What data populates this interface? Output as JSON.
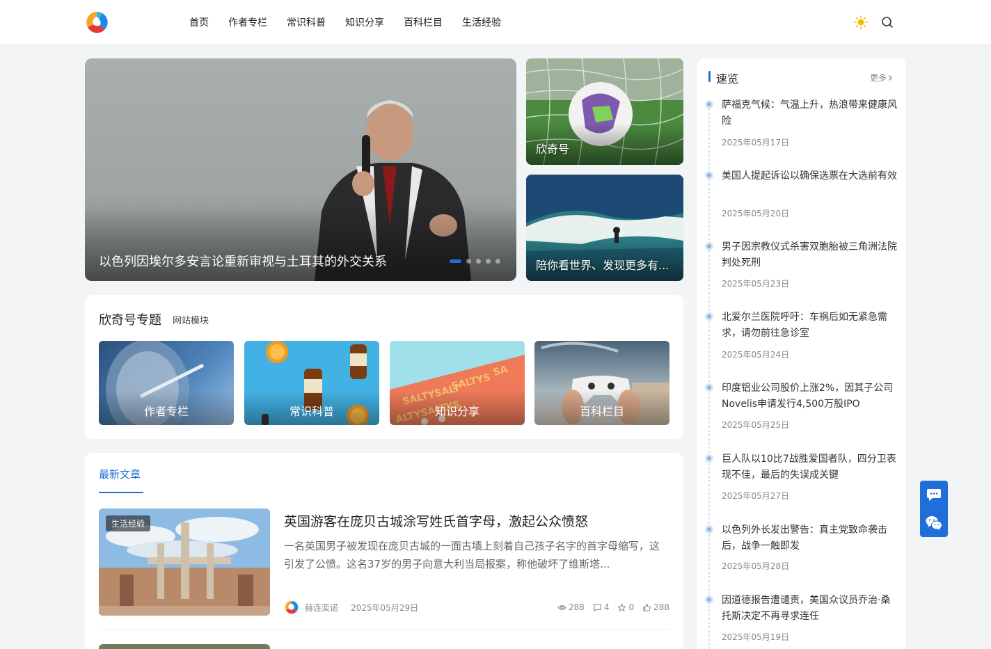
{
  "nav": [
    "首页",
    "作者专栏",
    "常识科普",
    "知识分享",
    "百科栏目",
    "生活经验"
  ],
  "icons": {
    "theme": "sun-icon",
    "search": "search-icon",
    "comment": "comment-icon",
    "wechat": "wechat-icon"
  },
  "colors": {
    "accent": "#1e6fd9",
    "theme_icon": "#f5b800"
  },
  "slider": {
    "title": "以色列因埃尔多安言论重新审视与土耳其的外交关系",
    "dots": 5,
    "active_dot": 1
  },
  "side_cards": [
    "欣奇号",
    "陪你看世界、发现更多有..."
  ],
  "topics": {
    "title": "欣奇号专题",
    "subtitle": "网站模块",
    "items": [
      "作者专栏",
      "常识科普",
      "知识分享",
      "百科栏目"
    ]
  },
  "latest": {
    "tab": "最新文章",
    "post": {
      "tag": "生活经验",
      "title": "英国游客在庞贝古城涂写姓氏首字母，激起公众愤怒",
      "excerpt": "一名英国男子被发现在庞贝古城的一面古墙上刻着自己孩子名字的首字母缩写，这引发了公愤。这名37岁的男子向意大利当局报案，称他破坏了维斯塔...",
      "author": "赫连栾诺",
      "date": "2025年05月29日",
      "views": "288",
      "comments": "4",
      "favorites": "0",
      "likes": "288"
    }
  },
  "sidebar": {
    "title": "速览",
    "more": "更多",
    "items": [
      {
        "title": "萨福克气候：气温上升，热浪带来健康风险",
        "date": "2025年05月17日"
      },
      {
        "title": "美国人提起诉讼以确保选票在大选前有效",
        "date": "2025年05月20日"
      },
      {
        "title": "男子因宗教仪式杀害双胞胎被三角洲法院判处死刑",
        "date": "2025年05月23日"
      },
      {
        "title": "北爱尔兰医院呼吁：车祸后如无紧急需求，请勿前往急诊室",
        "date": "2025年05月24日"
      },
      {
        "title": "印度铝业公司股价上涨2%，因其子公司Novelis申请发行4,500万股IPO",
        "date": "2025年05月25日"
      },
      {
        "title": "巨人队以10比7战胜爱国者队，四分卫表现不佳，最后的失误成关键",
        "date": "2025年05月27日"
      },
      {
        "title": "以色列外长发出警告：真主党致命袭击后，战争一触即发",
        "date": "2025年05月28日"
      },
      {
        "title": "因道德报告遭谴责，美国众议员乔治·桑托斯决定不再寻求连任",
        "date": "2025年05月19日"
      }
    ]
  }
}
